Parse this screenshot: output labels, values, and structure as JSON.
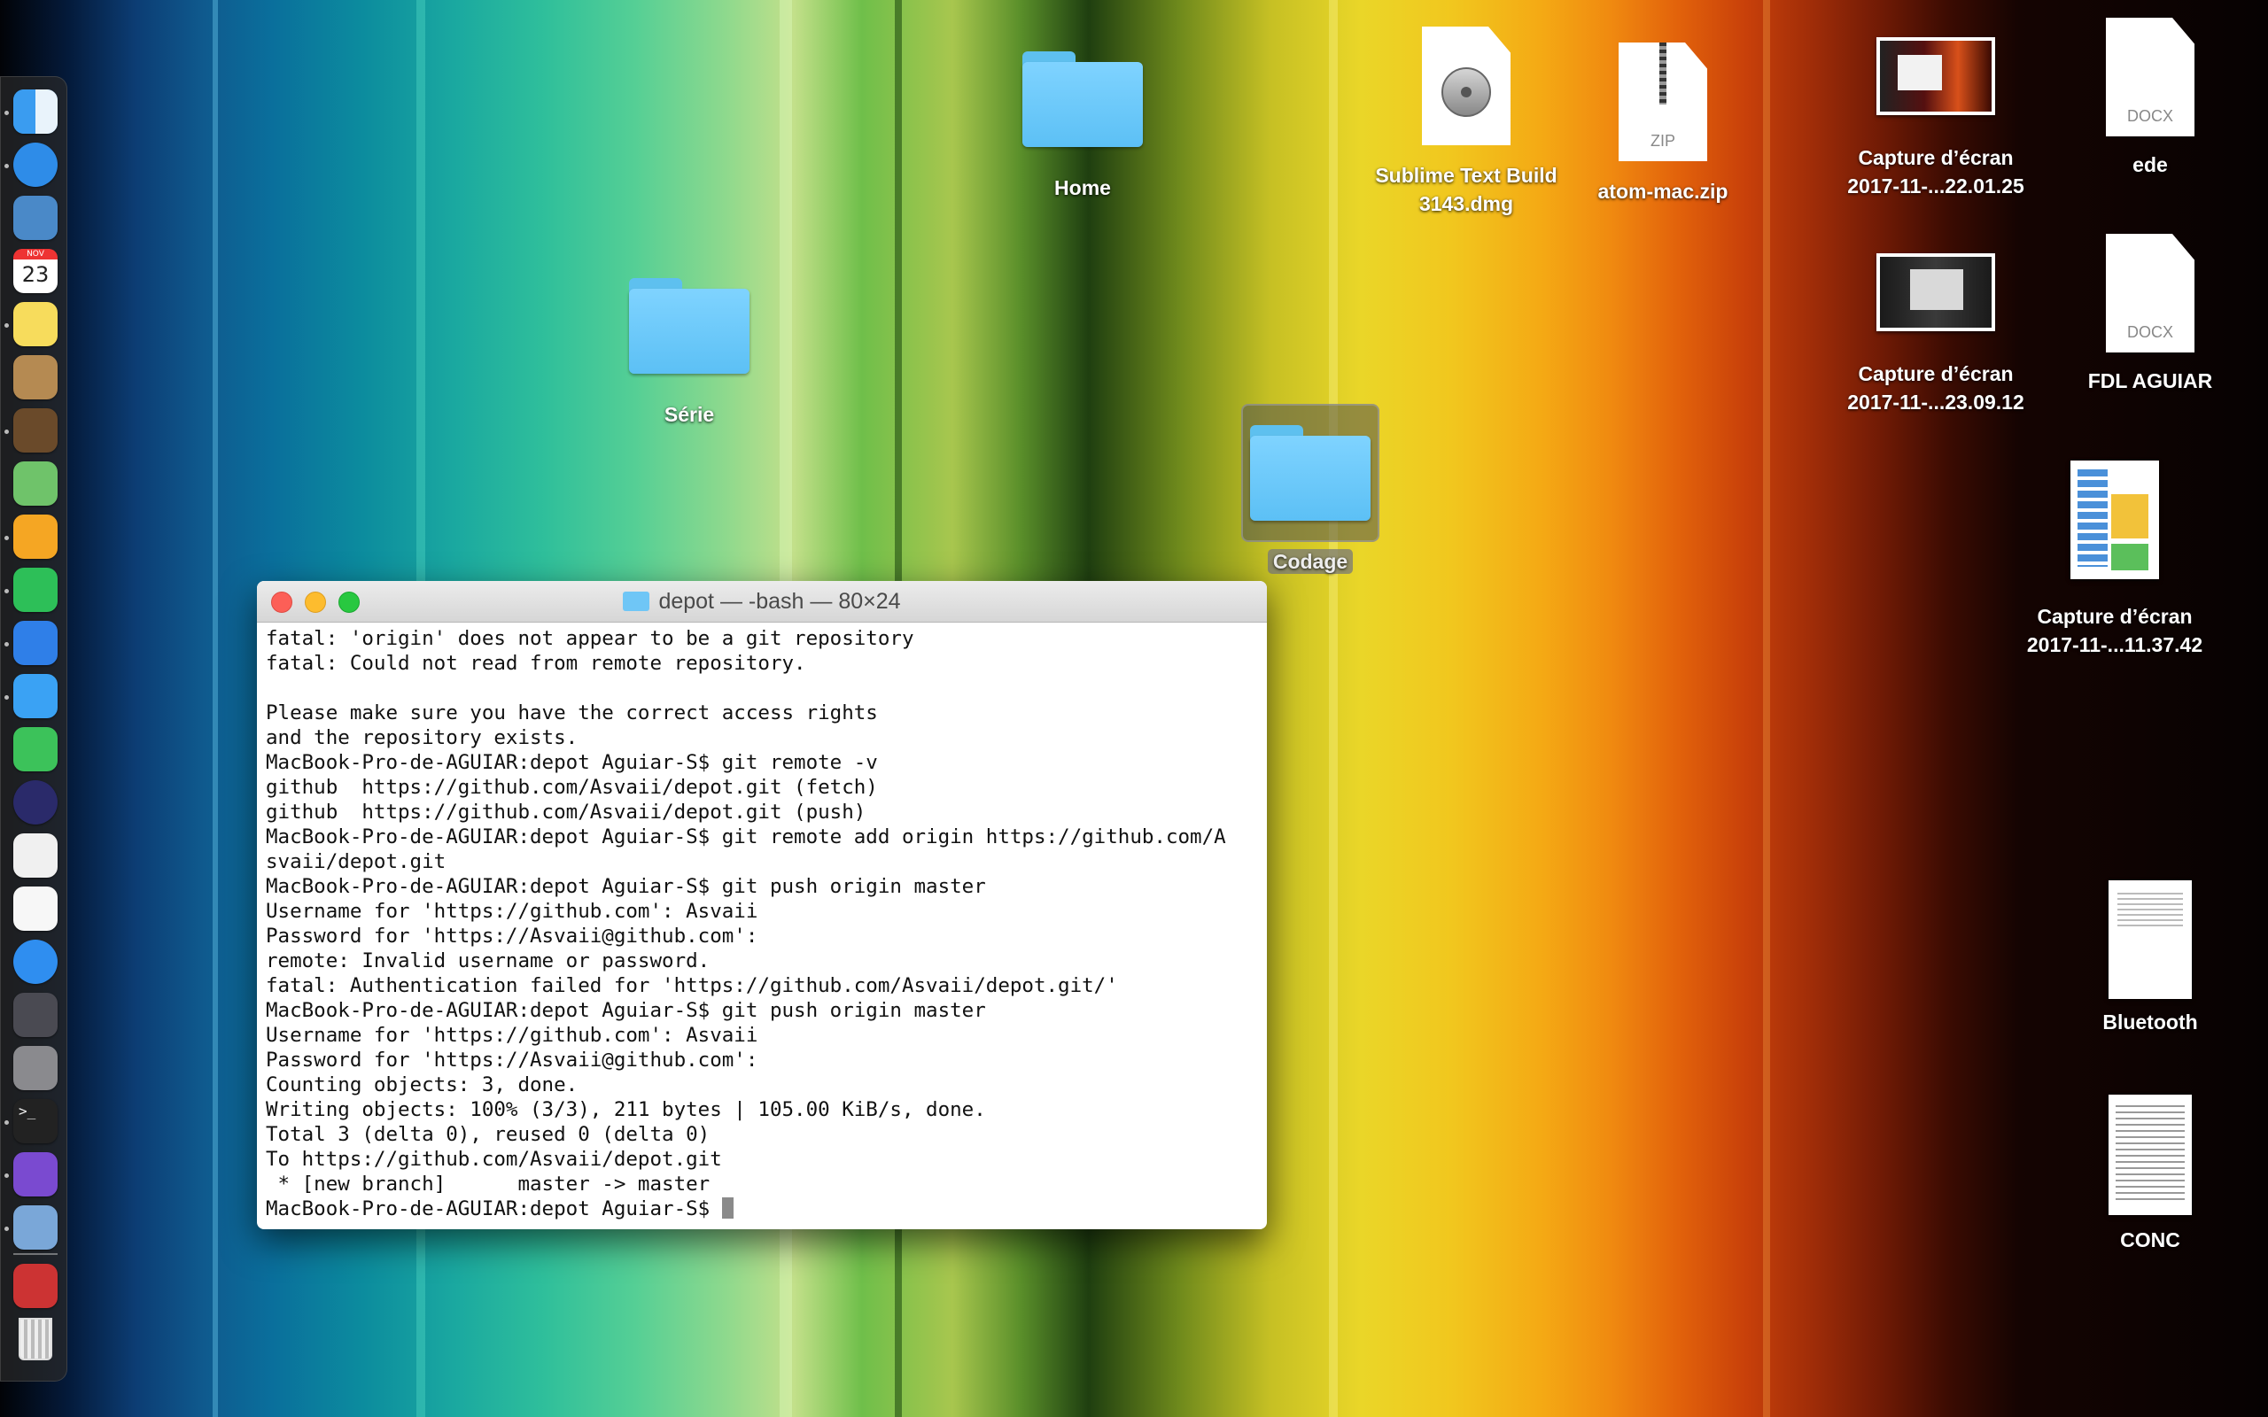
{
  "desktop": {
    "folders": [
      {
        "label": "Home"
      },
      {
        "label": "Série"
      },
      {
        "label": "Codage"
      }
    ],
    "files": [
      {
        "label_line1": "Sublime Text Build",
        "label_line2": "3143.dmg",
        "icon": "disk-image-icon"
      },
      {
        "label_line1": "atom-mac.zip",
        "label_line2": "",
        "icon": "zip-archive-icon",
        "ext": "ZIP"
      },
      {
        "label_line1": "Capture d’écran",
        "label_line2": "2017-11-...22.01.25",
        "icon": "screenshot-thumbnail-icon"
      },
      {
        "label_line1": "ede",
        "label_line2": "",
        "icon": "docx-icon",
        "ext": "DOCX"
      },
      {
        "label_line1": "Capture d’écran",
        "label_line2": "2017-11-...23.09.12",
        "icon": "screenshot-thumbnail-icon"
      },
      {
        "label_line1": "FDL AGUIAR",
        "label_line2": "",
        "icon": "docx-icon",
        "ext": "DOCX"
      },
      {
        "label_line1": "Capture d’écran",
        "label_line2": "2017-11-...11.37.42",
        "icon": "screenshot-thumbnail-icon"
      },
      {
        "label_line1": "Bluetooth",
        "label_line2": "",
        "icon": "document-preview-icon"
      },
      {
        "label_line1": "CONC",
        "label_line2": "",
        "icon": "document-preview-icon"
      }
    ]
  },
  "terminal": {
    "title": "depot — -bash — 80×24",
    "lines": [
      "fatal: 'origin' does not appear to be a git repository",
      "fatal: Could not read from remote repository.",
      "",
      "Please make sure you have the correct access rights",
      "and the repository exists.",
      "MacBook-Pro-de-AGUIAR:depot Aguiar-S$ git remote -v",
      "github  https://github.com/Asvaii/depot.git (fetch)",
      "github  https://github.com/Asvaii/depot.git (push)",
      "MacBook-Pro-de-AGUIAR:depot Aguiar-S$ git remote add origin https://github.com/A",
      "svaii/depot.git",
      "MacBook-Pro-de-AGUIAR:depot Aguiar-S$ git push origin master",
      "Username for 'https://github.com': Asvaii",
      "Password for 'https://Asvaii@github.com':",
      "remote: Invalid username or password.",
      "fatal: Authentication failed for 'https://github.com/Asvaii/depot.git/'",
      "MacBook-Pro-de-AGUIAR:depot Aguiar-S$ git push origin master",
      "Username for 'https://github.com': Asvaii",
      "Password for 'https://Asvaii@github.com':",
      "Counting objects: 3, done.",
      "Writing objects: 100% (3/3), 211 bytes | 105.00 KiB/s, done.",
      "Total 3 (delta 0), reused 0 (delta 0)",
      "To https://github.com/Asvaii/depot.git",
      " * [new branch]      master -> master",
      "MacBook-Pro-de-AGUIAR:depot Aguiar-S$ "
    ]
  },
  "dock": {
    "calendar_month": "NOV",
    "calendar_day": "23",
    "apps": [
      {
        "icon": "finder-icon",
        "color": "#3a9cf0"
      },
      {
        "icon": "safari-icon",
        "color": "#2e8ce8"
      },
      {
        "icon": "mail-icon",
        "color": "#4a89c8"
      },
      {
        "icon": "calendar-icon",
        "color": "#ffffff"
      },
      {
        "icon": "notes-icon",
        "color": "#f7dc5c"
      },
      {
        "icon": "contacts-icon",
        "color": "#b58a52"
      },
      {
        "icon": "garageband-icon",
        "color": "#6a4a2a"
      },
      {
        "icon": "maps-icon",
        "color": "#6fc36a"
      },
      {
        "icon": "pages-icon",
        "color": "#f5a623"
      },
      {
        "icon": "numbers-icon",
        "color": "#2dbf58"
      },
      {
        "icon": "keynote-icon",
        "color": "#2f7fe8"
      },
      {
        "icon": "messages-icon",
        "color": "#3aa2f4"
      },
      {
        "icon": "facetime-icon",
        "color": "#3cc25a"
      },
      {
        "icon": "siri-icon",
        "color": "#2a2a6a"
      },
      {
        "icon": "photos-icon",
        "color": "#f0f0f0"
      },
      {
        "icon": "itunes-icon",
        "color": "#f7f7f7"
      },
      {
        "icon": "app-store-icon",
        "color": "#2f8ef0"
      },
      {
        "icon": "launchpad-icon",
        "color": "#4a4a52"
      },
      {
        "icon": "system-preferences-icon",
        "color": "#8a8a8e"
      },
      {
        "icon": "terminal-icon",
        "color": "#222222"
      },
      {
        "icon": "github-desktop-icon",
        "color": "#7a4ad0"
      },
      {
        "icon": "preview-icon",
        "color": "#7aa7d8"
      },
      {
        "icon": "screenshot-stack-icon",
        "color": "#cc3333"
      },
      {
        "icon": "trash-icon",
        "color": "#d8d8d8"
      }
    ]
  }
}
